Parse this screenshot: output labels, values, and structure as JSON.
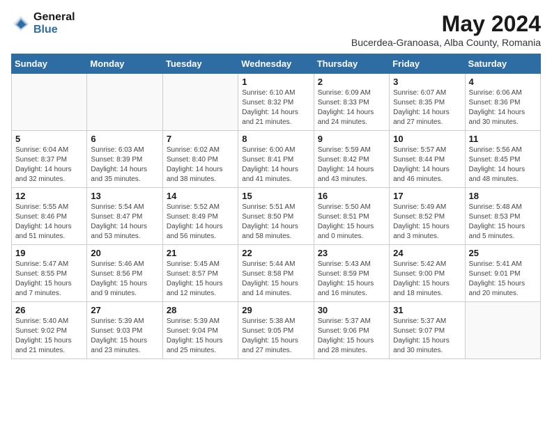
{
  "logo": {
    "general": "General",
    "blue": "Blue"
  },
  "title": "May 2024",
  "subtitle": "Bucerdea-Granoasa, Alba County, Romania",
  "days_of_week": [
    "Sunday",
    "Monday",
    "Tuesday",
    "Wednesday",
    "Thursday",
    "Friday",
    "Saturday"
  ],
  "weeks": [
    [
      {
        "day": "",
        "info": ""
      },
      {
        "day": "",
        "info": ""
      },
      {
        "day": "",
        "info": ""
      },
      {
        "day": "1",
        "info": "Sunrise: 6:10 AM\nSunset: 8:32 PM\nDaylight: 14 hours\nand 21 minutes."
      },
      {
        "day": "2",
        "info": "Sunrise: 6:09 AM\nSunset: 8:33 PM\nDaylight: 14 hours\nand 24 minutes."
      },
      {
        "day": "3",
        "info": "Sunrise: 6:07 AM\nSunset: 8:35 PM\nDaylight: 14 hours\nand 27 minutes."
      },
      {
        "day": "4",
        "info": "Sunrise: 6:06 AM\nSunset: 8:36 PM\nDaylight: 14 hours\nand 30 minutes."
      }
    ],
    [
      {
        "day": "5",
        "info": "Sunrise: 6:04 AM\nSunset: 8:37 PM\nDaylight: 14 hours\nand 32 minutes."
      },
      {
        "day": "6",
        "info": "Sunrise: 6:03 AM\nSunset: 8:39 PM\nDaylight: 14 hours\nand 35 minutes."
      },
      {
        "day": "7",
        "info": "Sunrise: 6:02 AM\nSunset: 8:40 PM\nDaylight: 14 hours\nand 38 minutes."
      },
      {
        "day": "8",
        "info": "Sunrise: 6:00 AM\nSunset: 8:41 PM\nDaylight: 14 hours\nand 41 minutes."
      },
      {
        "day": "9",
        "info": "Sunrise: 5:59 AM\nSunset: 8:42 PM\nDaylight: 14 hours\nand 43 minutes."
      },
      {
        "day": "10",
        "info": "Sunrise: 5:57 AM\nSunset: 8:44 PM\nDaylight: 14 hours\nand 46 minutes."
      },
      {
        "day": "11",
        "info": "Sunrise: 5:56 AM\nSunset: 8:45 PM\nDaylight: 14 hours\nand 48 minutes."
      }
    ],
    [
      {
        "day": "12",
        "info": "Sunrise: 5:55 AM\nSunset: 8:46 PM\nDaylight: 14 hours\nand 51 minutes."
      },
      {
        "day": "13",
        "info": "Sunrise: 5:54 AM\nSunset: 8:47 PM\nDaylight: 14 hours\nand 53 minutes."
      },
      {
        "day": "14",
        "info": "Sunrise: 5:52 AM\nSunset: 8:49 PM\nDaylight: 14 hours\nand 56 minutes."
      },
      {
        "day": "15",
        "info": "Sunrise: 5:51 AM\nSunset: 8:50 PM\nDaylight: 14 hours\nand 58 minutes."
      },
      {
        "day": "16",
        "info": "Sunrise: 5:50 AM\nSunset: 8:51 PM\nDaylight: 15 hours\nand 0 minutes."
      },
      {
        "day": "17",
        "info": "Sunrise: 5:49 AM\nSunset: 8:52 PM\nDaylight: 15 hours\nand 3 minutes."
      },
      {
        "day": "18",
        "info": "Sunrise: 5:48 AM\nSunset: 8:53 PM\nDaylight: 15 hours\nand 5 minutes."
      }
    ],
    [
      {
        "day": "19",
        "info": "Sunrise: 5:47 AM\nSunset: 8:55 PM\nDaylight: 15 hours\nand 7 minutes."
      },
      {
        "day": "20",
        "info": "Sunrise: 5:46 AM\nSunset: 8:56 PM\nDaylight: 15 hours\nand 9 minutes."
      },
      {
        "day": "21",
        "info": "Sunrise: 5:45 AM\nSunset: 8:57 PM\nDaylight: 15 hours\nand 12 minutes."
      },
      {
        "day": "22",
        "info": "Sunrise: 5:44 AM\nSunset: 8:58 PM\nDaylight: 15 hours\nand 14 minutes."
      },
      {
        "day": "23",
        "info": "Sunrise: 5:43 AM\nSunset: 8:59 PM\nDaylight: 15 hours\nand 16 minutes."
      },
      {
        "day": "24",
        "info": "Sunrise: 5:42 AM\nSunset: 9:00 PM\nDaylight: 15 hours\nand 18 minutes."
      },
      {
        "day": "25",
        "info": "Sunrise: 5:41 AM\nSunset: 9:01 PM\nDaylight: 15 hours\nand 20 minutes."
      }
    ],
    [
      {
        "day": "26",
        "info": "Sunrise: 5:40 AM\nSunset: 9:02 PM\nDaylight: 15 hours\nand 21 minutes."
      },
      {
        "day": "27",
        "info": "Sunrise: 5:39 AM\nSunset: 9:03 PM\nDaylight: 15 hours\nand 23 minutes."
      },
      {
        "day": "28",
        "info": "Sunrise: 5:39 AM\nSunset: 9:04 PM\nDaylight: 15 hours\nand 25 minutes."
      },
      {
        "day": "29",
        "info": "Sunrise: 5:38 AM\nSunset: 9:05 PM\nDaylight: 15 hours\nand 27 minutes."
      },
      {
        "day": "30",
        "info": "Sunrise: 5:37 AM\nSunset: 9:06 PM\nDaylight: 15 hours\nand 28 minutes."
      },
      {
        "day": "31",
        "info": "Sunrise: 5:37 AM\nSunset: 9:07 PM\nDaylight: 15 hours\nand 30 minutes."
      },
      {
        "day": "",
        "info": ""
      }
    ]
  ]
}
